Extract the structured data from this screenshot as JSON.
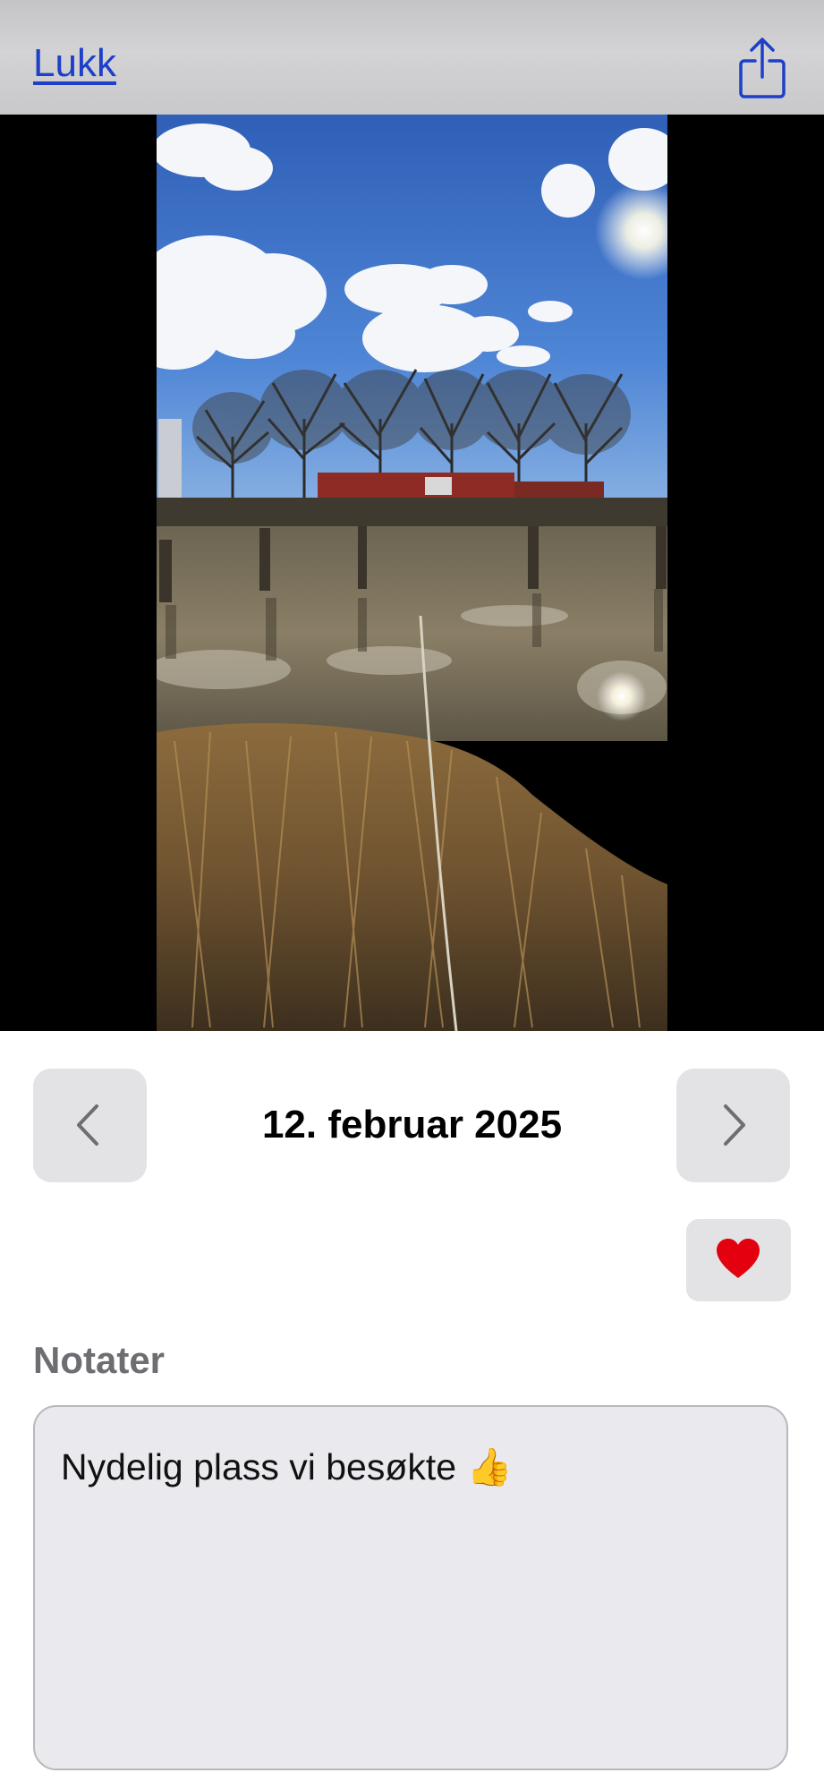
{
  "header": {
    "close_label": "Lukk",
    "share_icon": "share-icon"
  },
  "photo": {
    "description_icon": "photo"
  },
  "navigation": {
    "date": "12. februar 2025",
    "prev_icon": "chevron-left-icon",
    "next_icon": "chevron-right-icon"
  },
  "favorite": {
    "icon": "heart-icon",
    "color": "#e3000f"
  },
  "notes": {
    "label": "Notater",
    "value": "Nydelig plass vi besøkte 👍"
  },
  "colors": {
    "link": "#1d3fc9",
    "button_bg": "#e3e3e6",
    "notes_bg": "#e9e9ee"
  }
}
